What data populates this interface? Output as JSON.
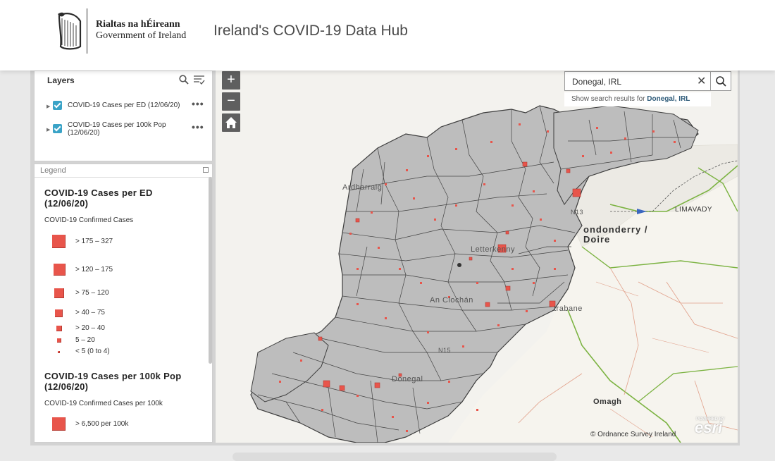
{
  "header": {
    "gov_line1": "Rialtas na hÉireann",
    "gov_line2": "Government of Ireland",
    "title": "Ireland's COVID-19 Data Hub"
  },
  "layers": {
    "title": "Layers",
    "items": [
      {
        "label": "COVID-19 Cases per ED (12/06/20)",
        "checked": true
      },
      {
        "label": "COVID-19 Cases per 100k Pop (12/06/20)",
        "checked": true
      }
    ],
    "more_label": "•••"
  },
  "legend": {
    "header": "Legend",
    "sections": [
      {
        "title": "COVID-19 Cases per ED (12/06/20)",
        "subtitle": "COVID-19 Confirmed Cases",
        "classes": [
          "> 175 – 327",
          "> 120 – 175",
          "> 75 – 120",
          "> 40 – 75",
          "> 20 – 40",
          "5 – 20",
          "< 5 (0 to 4)"
        ]
      },
      {
        "title": "COVID-19 Cases per 100k Pop (12/06/20)",
        "subtitle": "COVID-19 Confirmed Cases per 100k",
        "classes": [
          "> 6,500 per 100k"
        ]
      }
    ]
  },
  "map": {
    "zoom_in": "+",
    "zoom_out": "−",
    "search": {
      "value": "Donegal, IRL",
      "hint_prefix": "Show search results for",
      "hint_term": "Donegal, IRL"
    },
    "places": {
      "limavady": "LIMAVADY",
      "derry1": "ondonderry /",
      "derry2": "Doire",
      "letterkenny": "Letterkenny",
      "an_clochan": "An Clochán",
      "strabane": "trabane",
      "omagh": "Omagh",
      "ardara": "Ardharraig",
      "donegal": "Donegal",
      "n15": "N15",
      "n13": "N13"
    },
    "attribution": "© Ordnance Survey Ireland",
    "esri_small": "POWERED BY",
    "esri": "esri",
    "colors": {
      "county_fill": "#bdbdbd",
      "boundary": "#3d3d3d",
      "symbol": "#e8554b",
      "road_green": "#7cb342",
      "road_red": "#e1a08a"
    }
  }
}
